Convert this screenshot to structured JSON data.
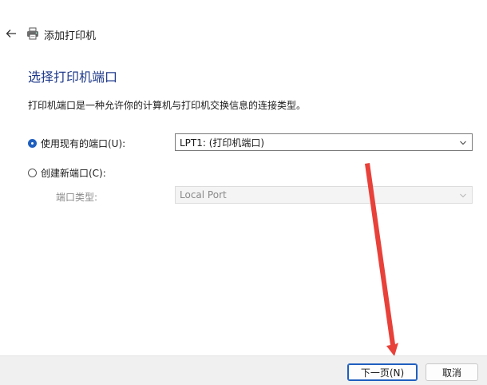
{
  "window": {
    "title": "添加打印机",
    "icons": {
      "back": "arrow-left-icon",
      "app": "printer-icon"
    }
  },
  "page": {
    "heading": "选择打印机端口",
    "description": "打印机端口是一种允许你的计算机与打印机交换信息的连接类型。"
  },
  "options": {
    "use_existing": {
      "label": "使用现有的端口(U):",
      "checked": true,
      "selected_value": "LPT1: (打印机端口)"
    },
    "create_new": {
      "label": "创建新端口(C):",
      "checked": false,
      "port_type_label": "端口类型:",
      "selected_value": "Local Port"
    }
  },
  "footer": {
    "next_label": "下一页(N)",
    "cancel_label": "取消"
  },
  "colors": {
    "heading": "#1f3a8a",
    "accent": "#1f5fbf",
    "annotation_arrow": "#e8413a"
  }
}
